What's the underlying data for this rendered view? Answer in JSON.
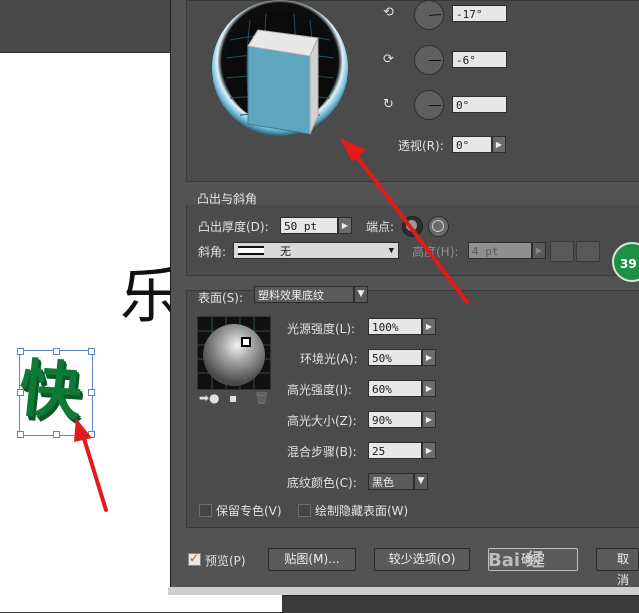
{
  "canvas": {
    "behind_char": "乐",
    "selected_text": "快"
  },
  "rotation": {
    "x_value": "-17°",
    "y_value": "-6°",
    "z_value": "0°",
    "perspective_label": "透视(R):",
    "perspective_value": "0°",
    "x_icon": "rotate-x-icon",
    "y_icon": "rotate-y-icon",
    "z_icon": "rotate-z-icon"
  },
  "extrude": {
    "group_title": "凸出与斜角",
    "depth_label": "凸出厚度(D):",
    "depth_value": "50 pt",
    "cap_label": "端点:",
    "bevel_label": "斜角:",
    "bevel_value": "无",
    "height_label": "高度(H):",
    "height_value": "4 pt"
  },
  "surface": {
    "label": "表面(S):",
    "value": "塑料效果底纹",
    "light_intensity_label": "光源强度(L):",
    "light_intensity": "100%",
    "ambient_label": "环境光(A):",
    "ambient": "50%",
    "highlight_intensity_label": "高光强度(I):",
    "highlight_intensity": "60%",
    "highlight_size_label": "高光大小(Z):",
    "highlight_size": "90%",
    "blend_steps_label": "混合步骤(B):",
    "blend_steps": "25",
    "shading_color_label": "底纹颜色(C):",
    "shading_color": "黑色",
    "preserve_spot_label": "保留专色(V)",
    "draw_hidden_label": "绘制隐藏表面(W)"
  },
  "footer": {
    "preview_label": "预览(P)",
    "map_art_label": "贴图(M)...",
    "fewer_options_label": "较少选项(O)",
    "ok_label": "确定",
    "cancel_label": "取消"
  },
  "badge": "39",
  "watermark": "Bai 经",
  "colors": {
    "dialog_bg": "#535353",
    "cube_face": "#5fa6bf",
    "text_green": "#0f7a35",
    "arrow_red": "#e21a1a"
  }
}
